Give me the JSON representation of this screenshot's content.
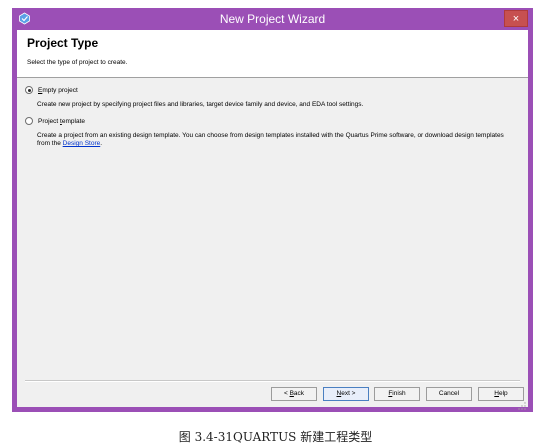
{
  "window": {
    "title": "New Project Wizard",
    "close_glyph": "×",
    "icons": {
      "app": "quartus-app-icon",
      "close": "close-icon"
    }
  },
  "page": {
    "title": "Project Type",
    "subtitle": "Select the type of project to create."
  },
  "options": [
    {
      "label": "Empty project",
      "mnemonic": "E",
      "rest": "mpty project",
      "selected": true,
      "description": "Create new project by specifying project files and libraries, target device family and device, and EDA tool settings."
    },
    {
      "label": "Project template",
      "prefix": "Project ",
      "mnemonic": "t",
      "rest": "emplate",
      "selected": false,
      "description_before_link": "Create a project from an existing design template. You can choose from design templates installed with the Quartus Prime software, or download design templates from the ",
      "link_text": "Design Store",
      "description_after_link": "."
    }
  ],
  "buttons": {
    "back": {
      "before": "< ",
      "mnemonic": "B",
      "after": "ack"
    },
    "next": {
      "before": "",
      "mnemonic": "N",
      "after": "ext >"
    },
    "finish": {
      "before": "",
      "mnemonic": "F",
      "after": "inish"
    },
    "cancel": "Cancel",
    "help": {
      "before": "",
      "mnemonic": "H",
      "after": "elp"
    }
  },
  "caption": "图 3.4-31QUARTUS 新建工程类型",
  "colors": {
    "titlebar": "#9b4fb6",
    "close": "#c75050",
    "client": "#f0f0f0",
    "link": "#0033cc"
  }
}
